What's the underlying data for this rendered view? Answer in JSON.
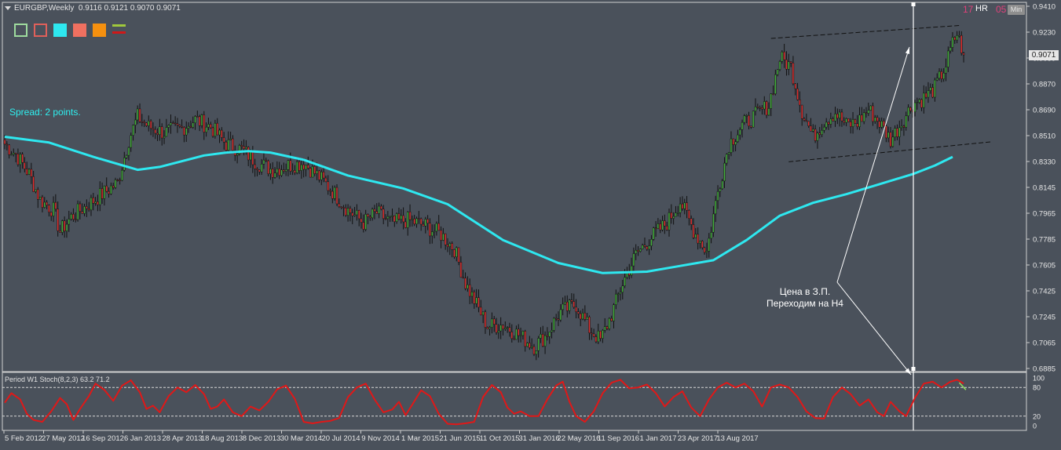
{
  "header": {
    "symbol": "EURGBP,Weekly",
    "ohlc": "0.9116 0.9121 0.9070 0.9071"
  },
  "spread_text": "Spread: 2 points.",
  "toolbar": {
    "items": [
      {
        "name": "frame-green",
        "color": "#9edb9e",
        "style": "outline"
      },
      {
        "name": "frame-red",
        "color": "#e0605a",
        "style": "outline"
      },
      {
        "name": "fill-cyan",
        "color": "#2ee8f0",
        "style": "fill"
      },
      {
        "name": "fill-salmon",
        "color": "#f07060",
        "style": "fill"
      },
      {
        "name": "fill-orange",
        "color": "#f5900f",
        "style": "fill"
      },
      {
        "name": "lines-green-red",
        "color": "#a0c83c",
        "color2": "#d01818",
        "style": "lines"
      }
    ]
  },
  "hr_panel": {
    "hour": "17",
    "hr_label": "HR",
    "min": "05",
    "min_label": "Min"
  },
  "current_price": "0.9071",
  "annotation": {
    "line1": "Цена в З.П.",
    "line2": "Переходим на H4"
  },
  "stoch_label": "Period W1 Stoch(8,2,3) 63.2 71.2",
  "colors": {
    "background": "#4a515b",
    "bull_candle": "#44b03c",
    "bear_candle": "#e03030",
    "candle_outline": "#111111",
    "ma": "#2ee8f0",
    "stoch": "#e01818",
    "signal": "#90e060",
    "grid": "#d0d0d0",
    "text": "#e6e6e6"
  },
  "chart_data": {
    "type": "candlestick",
    "title": "EURGBP,Weekly",
    "ylim": [
      0.6885,
      0.941
    ],
    "y_ticks": [
      "0.9410",
      "0.9230",
      "0.9050",
      "0.8870",
      "0.8690",
      "0.8510",
      "0.8330",
      "0.8145",
      "0.7965",
      "0.7785",
      "0.7605",
      "0.7425",
      "0.7245",
      "0.7065",
      "0.6885"
    ],
    "x_tick_labels": [
      "5 Feb 2012",
      "27 May 2012",
      "16 Sep 2012",
      "6 Jan 2013",
      "28 Apr 2013",
      "18 Aug 2013",
      "8 Dec 2013",
      "30 Mar 2014",
      "20 Jul 2014",
      "9 Nov 2014",
      "1 Mar 2015",
      "21 Jun 2015",
      "11 Oct 2015",
      "31 Jan 2016",
      "22 May 2016",
      "11 Sep 2016",
      "1 Jan 2017",
      "23 Apr 2017",
      "13 Aug 2017"
    ],
    "price_anchors": [
      [
        0,
        0.845
      ],
      [
        5,
        0.838
      ],
      [
        11,
        0.824
      ],
      [
        16,
        0.806
      ],
      [
        22,
        0.799
      ],
      [
        25,
        0.784
      ],
      [
        30,
        0.794
      ],
      [
        37,
        0.802
      ],
      [
        44,
        0.81
      ],
      [
        51,
        0.818
      ],
      [
        56,
        0.848
      ],
      [
        60,
        0.864
      ],
      [
        65,
        0.857
      ],
      [
        72,
        0.853
      ],
      [
        80,
        0.856
      ],
      [
        86,
        0.862
      ],
      [
        93,
        0.857
      ],
      [
        100,
        0.845
      ],
      [
        107,
        0.841
      ],
      [
        114,
        0.832
      ],
      [
        121,
        0.827
      ],
      [
        128,
        0.83
      ],
      [
        135,
        0.832
      ],
      [
        142,
        0.822
      ],
      [
        148,
        0.812
      ],
      [
        155,
        0.799
      ],
      [
        162,
        0.79
      ],
      [
        168,
        0.797
      ],
      [
        175,
        0.79
      ],
      [
        182,
        0.792
      ],
      [
        190,
        0.788
      ],
      [
        197,
        0.782
      ],
      [
        203,
        0.772
      ],
      [
        208,
        0.748
      ],
      [
        213,
        0.733
      ],
      [
        218,
        0.718
      ],
      [
        225,
        0.719
      ],
      [
        232,
        0.712
      ],
      [
        239,
        0.704
      ],
      [
        244,
        0.711
      ],
      [
        251,
        0.728
      ],
      [
        258,
        0.733
      ],
      [
        264,
        0.716
      ],
      [
        269,
        0.708
      ],
      [
        274,
        0.726
      ],
      [
        279,
        0.748
      ],
      [
        285,
        0.768
      ],
      [
        292,
        0.78
      ],
      [
        299,
        0.79
      ],
      [
        305,
        0.805
      ],
      [
        311,
        0.785
      ],
      [
        317,
        0.77
      ],
      [
        322,
        0.812
      ],
      [
        327,
        0.845
      ],
      [
        333,
        0.858
      ],
      [
        339,
        0.865
      ],
      [
        345,
        0.872
      ],
      [
        350,
        0.905
      ],
      [
        355,
        0.899
      ],
      [
        360,
        0.868
      ],
      [
        365,
        0.85
      ],
      [
        370,
        0.861
      ],
      [
        375,
        0.867
      ],
      [
        380,
        0.858
      ],
      [
        385,
        0.86
      ],
      [
        390,
        0.869
      ],
      [
        395,
        0.86
      ],
      [
        400,
        0.848
      ],
      [
        405,
        0.86
      ],
      [
        410,
        0.873
      ],
      [
        415,
        0.877
      ],
      [
        420,
        0.884
      ],
      [
        425,
        0.9
      ],
      [
        428,
        0.915
      ],
      [
        430,
        0.922
      ],
      [
        433,
        0.9075
      ]
    ],
    "ma_series": {
      "name": "",
      "points": [
        [
          0,
          0.85
        ],
        [
          20,
          0.846
        ],
        [
          40,
          0.836
        ],
        [
          60,
          0.827
        ],
        [
          70,
          0.829
        ],
        [
          90,
          0.837
        ],
        [
          100,
          0.839
        ],
        [
          110,
          0.84
        ],
        [
          120,
          0.839
        ],
        [
          135,
          0.834
        ],
        [
          155,
          0.823
        ],
        [
          180,
          0.814
        ],
        [
          200,
          0.803
        ],
        [
          225,
          0.778
        ],
        [
          250,
          0.762
        ],
        [
          270,
          0.755
        ],
        [
          290,
          0.756
        ],
        [
          305,
          0.76
        ],
        [
          320,
          0.764
        ],
        [
          335,
          0.778
        ],
        [
          350,
          0.795
        ],
        [
          365,
          0.804
        ],
        [
          380,
          0.81
        ],
        [
          395,
          0.817
        ],
        [
          410,
          0.824
        ],
        [
          420,
          0.83
        ],
        [
          428,
          0.836
        ]
      ]
    },
    "channel_lines": [
      {
        "from": [
          0.9186,
          "Sep 2016"
        ],
        "to": [
          0.9276,
          "Sep 2017"
        ]
      },
      {
        "from": [
          0.8326,
          "Nov 2016"
        ],
        "to": [
          0.8466,
          "Oct 2017"
        ]
      }
    ],
    "stochastic": {
      "label": "Period W1 Stoch(8,2,3) 63.2 71.2",
      "ylim": [
        0,
        100
      ],
      "levels": [
        80,
        20
      ],
      "tick_labels": [
        "100",
        "80",
        "20",
        "0"
      ],
      "k_anchors": [
        [
          0,
          48
        ],
        [
          3,
          68
        ],
        [
          7,
          55
        ],
        [
          10,
          25
        ],
        [
          13,
          12
        ],
        [
          17,
          8
        ],
        [
          21,
          30
        ],
        [
          25,
          58
        ],
        [
          28,
          45
        ],
        [
          31,
          12
        ],
        [
          34,
          35
        ],
        [
          38,
          62
        ],
        [
          41,
          88
        ],
        [
          45,
          75
        ],
        [
          49,
          52
        ],
        [
          53,
          84
        ],
        [
          57,
          95
        ],
        [
          61,
          70
        ],
        [
          64,
          35
        ],
        [
          67,
          42
        ],
        [
          70,
          28
        ],
        [
          74,
          62
        ],
        [
          78,
          80
        ],
        [
          82,
          70
        ],
        [
          86,
          85
        ],
        [
          90,
          66
        ],
        [
          93,
          35
        ],
        [
          96,
          40
        ],
        [
          99,
          55
        ],
        [
          103,
          28
        ],
        [
          107,
          20
        ],
        [
          111,
          40
        ],
        [
          115,
          32
        ],
        [
          119,
          50
        ],
        [
          123,
          76
        ],
        [
          127,
          84
        ],
        [
          131,
          56
        ],
        [
          135,
          8
        ],
        [
          139,
          5
        ],
        [
          143,
          8
        ],
        [
          147,
          10
        ],
        [
          151,
          16
        ],
        [
          155,
          60
        ],
        [
          159,
          80
        ],
        [
          163,
          88
        ],
        [
          167,
          55
        ],
        [
          171,
          28
        ],
        [
          175,
          34
        ],
        [
          178,
          50
        ],
        [
          181,
          22
        ],
        [
          184,
          44
        ],
        [
          188,
          74
        ],
        [
          192,
          62
        ],
        [
          196,
          25
        ],
        [
          200,
          4
        ],
        [
          204,
          3
        ],
        [
          208,
          5
        ],
        [
          212,
          8
        ],
        [
          216,
          60
        ],
        [
          220,
          85
        ],
        [
          224,
          70
        ],
        [
          227,
          38
        ],
        [
          230,
          25
        ],
        [
          233,
          30
        ],
        [
          237,
          20
        ],
        [
          241,
          20
        ],
        [
          245,
          55
        ],
        [
          249,
          84
        ],
        [
          252,
          92
        ],
        [
          255,
          50
        ],
        [
          258,
          20
        ],
        [
          262,
          8
        ],
        [
          266,
          30
        ],
        [
          270,
          68
        ],
        [
          274,
          90
        ],
        [
          278,
          96
        ],
        [
          282,
          78
        ],
        [
          286,
          80
        ],
        [
          290,
          86
        ],
        [
          294,
          68
        ],
        [
          298,
          40
        ],
        [
          302,
          60
        ],
        [
          306,
          72
        ],
        [
          310,
          38
        ],
        [
          314,
          20
        ],
        [
          318,
          55
        ],
        [
          322,
          80
        ],
        [
          326,
          90
        ],
        [
          330,
          80
        ],
        [
          334,
          88
        ],
        [
          338,
          72
        ],
        [
          342,
          40
        ],
        [
          346,
          80
        ],
        [
          350,
          86
        ],
        [
          354,
          80
        ],
        [
          358,
          60
        ],
        [
          362,
          30
        ],
        [
          366,
          16
        ],
        [
          370,
          15
        ],
        [
          374,
          60
        ],
        [
          378,
          80
        ],
        [
          382,
          66
        ],
        [
          386,
          42
        ],
        [
          390,
          55
        ],
        [
          394,
          28
        ],
        [
          397,
          20
        ],
        [
          400,
          50
        ],
        [
          404,
          30
        ],
        [
          407,
          20
        ],
        [
          411,
          58
        ],
        [
          415,
          88
        ],
        [
          419,
          92
        ],
        [
          423,
          80
        ],
        [
          427,
          92
        ],
        [
          430,
          96
        ],
        [
          433,
          88
        ]
      ]
    }
  }
}
